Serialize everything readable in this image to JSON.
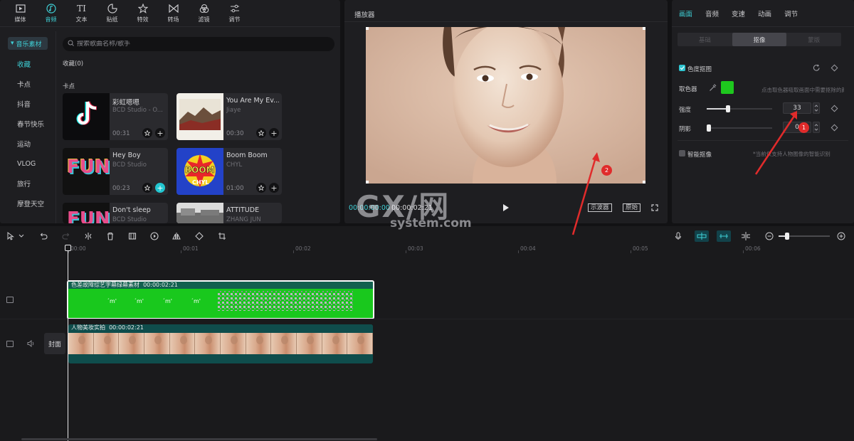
{
  "toolbar": {
    "items": [
      {
        "label": "媒体",
        "icon": "media-icon"
      },
      {
        "label": "音频",
        "icon": "audio-icon"
      },
      {
        "label": "文本",
        "icon": "text-icon"
      },
      {
        "label": "贴纸",
        "icon": "sticker-icon"
      },
      {
        "label": "特效",
        "icon": "effects-icon"
      },
      {
        "label": "转场",
        "icon": "transition-icon"
      },
      {
        "label": "滤镜",
        "icon": "filter-icon"
      },
      {
        "label": "调节",
        "icon": "adjust-icon"
      }
    ],
    "active_index": 1,
    "text_icon_glyph": "TI"
  },
  "sidebar": {
    "header": "音乐素材",
    "items": [
      "收藏",
      "卡点",
      "抖音",
      "春节快乐",
      "运动",
      "VLOG",
      "旅行",
      "摩登天空"
    ],
    "active_index": 0
  },
  "search": {
    "placeholder": "搜索歌曲名称/歌手"
  },
  "sections": {
    "favorites": "收藏(0)",
    "beat": "卡点"
  },
  "cards": [
    {
      "title": "彩虹嗯嗯",
      "artist": "BCD Studio - O...",
      "duration": "00:31"
    },
    {
      "title": "You Are My Ev...",
      "artist": "Jiaye",
      "duration": "00:30"
    },
    {
      "title": "Hey Boy",
      "artist": "BCD Studio",
      "duration": "00:23"
    },
    {
      "title": "Boom Boom",
      "artist": "CHYL",
      "duration": "01:00"
    },
    {
      "title": "Don't sleep",
      "artist": "BCD Studio",
      "duration": ""
    },
    {
      "title": "ATTITUDE",
      "artist": "ZHANG JUN",
      "duration": ""
    }
  ],
  "card_art": {
    "fun": "FUN",
    "boom": "BOOM",
    "chyl": "CHYL"
  },
  "player": {
    "title": "播放器",
    "current_time": "00:00:00:00",
    "total_time": "00:00:02:21",
    "scope_btn": "示波器",
    "original_btn": "原始"
  },
  "props": {
    "tabs": [
      "画面",
      "音频",
      "变速",
      "动画",
      "调节"
    ],
    "active_tab": 0,
    "subtabs": [
      "基础",
      "抠像",
      "蒙版"
    ],
    "active_subtab": 1,
    "chroma_key_label": "色度抠图",
    "picker_label": "取色器",
    "picker_color": "#1ec81e",
    "picker_hint": "点击取色器吸取画面中需要抠除的颜色",
    "strength_label": "强度",
    "strength_value": "33",
    "strength_level": 0.33,
    "shadow_label": "阴影",
    "shadow_value": "0",
    "shadow_level": 0,
    "smart_label": "智能抠像",
    "smart_hint": "*当前仅支持人物图像的智能识别"
  },
  "timeline": {
    "ruler": [
      "00:00",
      "00:01",
      "00:02",
      "00:03",
      "00:04",
      "00:05",
      "00:06"
    ],
    "green_clip_name": "色差故障综艺字幕绿幕素材",
    "green_clip_duration": "00:00:02:21",
    "video_clip_name": "人物美妆实拍",
    "video_clip_duration": "00:00:02:21",
    "cover_label": "封面"
  },
  "watermark": {
    "brand": "GX/网",
    "domain": "system.com"
  },
  "annotations": {
    "badge1": "1",
    "badge2": "2"
  },
  "colors": {
    "accent": "#3fd0d6",
    "chroma_green": "#19c81d",
    "arrow_red": "#e02b2b"
  }
}
